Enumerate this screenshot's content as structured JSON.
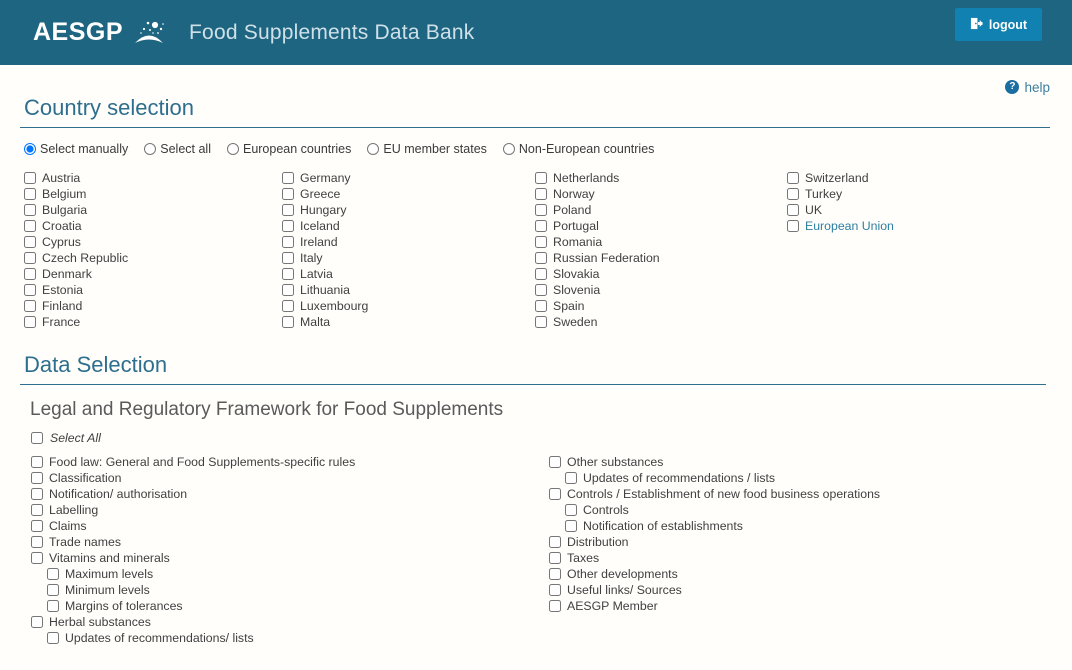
{
  "header": {
    "logo_text": "AESGP",
    "logo_mark_icon": "aesgp-swoosh-icon",
    "app_title": "Food Supplements Data Bank",
    "logout_label": "logout",
    "logout_icon": "logout-door-icon",
    "bg_color": "#1d6580",
    "logout_color": "#1081b0"
  },
  "help": {
    "label": "help",
    "icon": "question-mark-icon"
  },
  "country_selection": {
    "title": "Country selection",
    "modes": [
      {
        "label": "Select manually",
        "selected": true
      },
      {
        "label": "Select all",
        "selected": false
      },
      {
        "label": "European countries",
        "selected": false
      },
      {
        "label": "EU member states",
        "selected": false
      },
      {
        "label": "Non-European countries",
        "selected": false
      }
    ],
    "columns": [
      [
        "Austria",
        "Belgium",
        "Bulgaria",
        "Croatia",
        "Cyprus",
        "Czech Republic",
        "Denmark",
        "Estonia",
        "Finland",
        "France"
      ],
      [
        "Germany",
        "Greece",
        "Hungary",
        "Iceland",
        "Ireland",
        "Italy",
        "Latvia",
        "Lithuania",
        "Luxembourg",
        "Malta"
      ],
      [
        "Netherlands",
        "Norway",
        "Poland",
        "Portugal",
        "Romania",
        "Russian Federation",
        "Slovakia",
        "Slovenia",
        "Spain",
        "Sweden"
      ],
      [
        "Switzerland",
        "Turkey",
        "UK",
        "European Union"
      ]
    ],
    "accent_items": [
      "European Union"
    ],
    "accent_color": "#2e7fa0"
  },
  "data_selection": {
    "title": "Data Selection",
    "subtitle": "Legal and Regulatory Framework for Food Supplements",
    "select_all_label": "Select All",
    "left_column": [
      {
        "label": "Food law: General and Food Supplements-specific rules",
        "indent": 0
      },
      {
        "label": "Classification",
        "indent": 0
      },
      {
        "label": "Notification/ authorisation",
        "indent": 0
      },
      {
        "label": "Labelling",
        "indent": 0
      },
      {
        "label": "Claims",
        "indent": 0
      },
      {
        "label": "Trade names",
        "indent": 0
      },
      {
        "label": "Vitamins and minerals",
        "indent": 0
      },
      {
        "label": "Maximum levels",
        "indent": 1
      },
      {
        "label": "Minimum levels",
        "indent": 1
      },
      {
        "label": "Margins of tolerances",
        "indent": 1
      },
      {
        "label": "Herbal substances",
        "indent": 0
      },
      {
        "label": "Updates of recommendations/ lists",
        "indent": 1
      }
    ],
    "right_column": [
      {
        "label": "Other substances",
        "indent": 0
      },
      {
        "label": "Updates of recommendations / lists",
        "indent": 1
      },
      {
        "label": "Controls / Establishment of new food business operations",
        "indent": 0
      },
      {
        "label": "Controls",
        "indent": 1
      },
      {
        "label": "Notification of establishments",
        "indent": 1
      },
      {
        "label": "Distribution",
        "indent": 0
      },
      {
        "label": "Taxes",
        "indent": 0
      },
      {
        "label": "Other developments",
        "indent": 0
      },
      {
        "label": "Useful links/ Sources",
        "indent": 0
      },
      {
        "label": "AESGP Member",
        "indent": 0
      }
    ]
  }
}
